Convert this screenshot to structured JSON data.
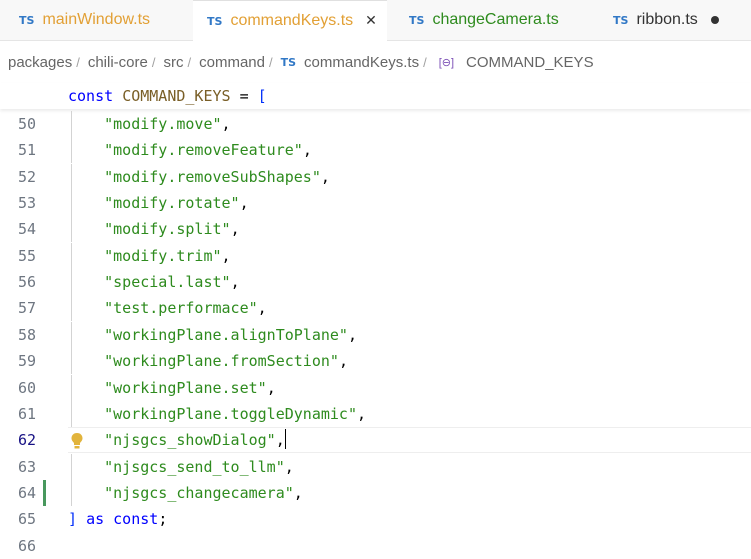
{
  "colors": {
    "ts_badge": "#3178c6",
    "tab_modified_orange": "#e2a035",
    "tab_added_green": "#2e8b1e",
    "string": "#2e8b1e",
    "keyword": "#0000ff",
    "variable": "#795e26",
    "line_number": "#6e7681",
    "current_line_number": "#171184",
    "change_bar": "#48985d"
  },
  "tabs": [
    {
      "badge": "TS",
      "label": "mainWindow.ts",
      "label_color": "#e2a035",
      "active": false
    },
    {
      "badge": "TS",
      "label": "commandKeys.ts",
      "label_color": "#e2a035",
      "active": true,
      "close_glyph": "✕"
    },
    {
      "badge": "TS",
      "label": "changeCamera.ts",
      "label_color": "#2e8b1e",
      "active": false
    },
    {
      "badge": "TS",
      "label": "ribbon.ts",
      "label_color": "#333333",
      "active": false,
      "dirty": true
    }
  ],
  "breadcrumb": {
    "items": [
      "packages",
      "chili-core",
      "src",
      "command"
    ],
    "file_badge": "TS",
    "file": "commandKeys.ts",
    "symbol_icon": "symbol-constant-icon",
    "symbol_glyph": "[⊖]",
    "symbol": "COMMAND_KEYS",
    "separator": "/"
  },
  "sticky": {
    "keyword": "const",
    "name": "COMMAND_KEYS",
    "op": " = ",
    "bracket": "["
  },
  "lines": [
    {
      "num": "50",
      "text": "\"modify.move\"",
      "trail": ","
    },
    {
      "num": "51",
      "text": "\"modify.removeFeature\"",
      "trail": ","
    },
    {
      "num": "52",
      "text": "\"modify.removeSubShapes\"",
      "trail": ","
    },
    {
      "num": "53",
      "text": "\"modify.rotate\"",
      "trail": ","
    },
    {
      "num": "54",
      "text": "\"modify.split\"",
      "trail": ","
    },
    {
      "num": "55",
      "text": "\"modify.trim\"",
      "trail": ","
    },
    {
      "num": "56",
      "text": "\"special.last\"",
      "trail": ","
    },
    {
      "num": "57",
      "text": "\"test.performace\"",
      "trail": ","
    },
    {
      "num": "58",
      "text": "\"workingPlane.alignToPlane\"",
      "trail": ","
    },
    {
      "num": "59",
      "text": "\"workingPlane.fromSection\"",
      "trail": ","
    },
    {
      "num": "60",
      "text": "\"workingPlane.set\"",
      "trail": ","
    },
    {
      "num": "61",
      "text": "\"workingPlane.toggleDynamic\"",
      "trail": ","
    },
    {
      "num": "62",
      "text": "\"njsgcs_showDialog\"",
      "trail": ",",
      "current": true,
      "lightbulb": true
    },
    {
      "num": "63",
      "text": "\"njsgcs_send_to_llm\"",
      "trail": ","
    },
    {
      "num": "64",
      "text": "\"njsgcs_changecamera\"",
      "trail": ",",
      "changed": true
    },
    {
      "num": "65",
      "close_bracket": "]",
      "as_kw": "as",
      "const_kw": "const",
      "semi": ";"
    },
    {
      "num": "66"
    }
  ]
}
